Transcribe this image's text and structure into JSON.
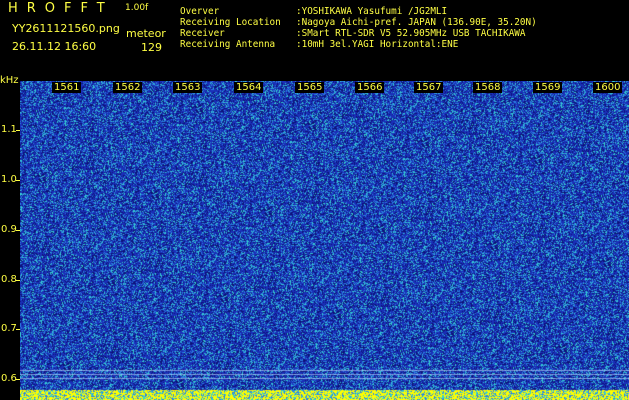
{
  "header": {
    "app_name": "HROFFT",
    "version": "1.00f",
    "filename": "YY2611121560.png",
    "mode": "meteor",
    "datetime": "26.11.12 16:60",
    "count": "129"
  },
  "station_info": [
    {
      "label": "Overver",
      "value": ":YOSHIKAWA Yasufumi /JG2MLI"
    },
    {
      "label": "Receiving Location",
      "value": ":Nagoya Aichi-pref. JAPAN (136.90E, 35.20N)"
    },
    {
      "label": "Receiver",
      "value": ":SMart RTL-SDR V5 52.905MHz USB TACHIKAWA"
    },
    {
      "label": "Receiving Antenna",
      "value": ":10mH 3el.YAGI Horizontal:ENE"
    }
  ],
  "y_axis": {
    "unit": "kHz",
    "ticks": [
      "1.1",
      "1.0",
      "0.9",
      "0.8",
      "0.7",
      "0.6"
    ]
  },
  "x_axis": {
    "ticks": [
      "1561",
      "1562",
      "1563",
      "1564",
      "1565",
      "1566",
      "1567",
      "1568",
      "1569",
      "1600"
    ]
  },
  "colors": {
    "text": "#ffff44",
    "background": "#000000",
    "noise_low": "#1a2fb8",
    "noise_mid": "#2a7fe0",
    "noise_high": "#35d0d0",
    "peak": "#ffff00"
  }
}
